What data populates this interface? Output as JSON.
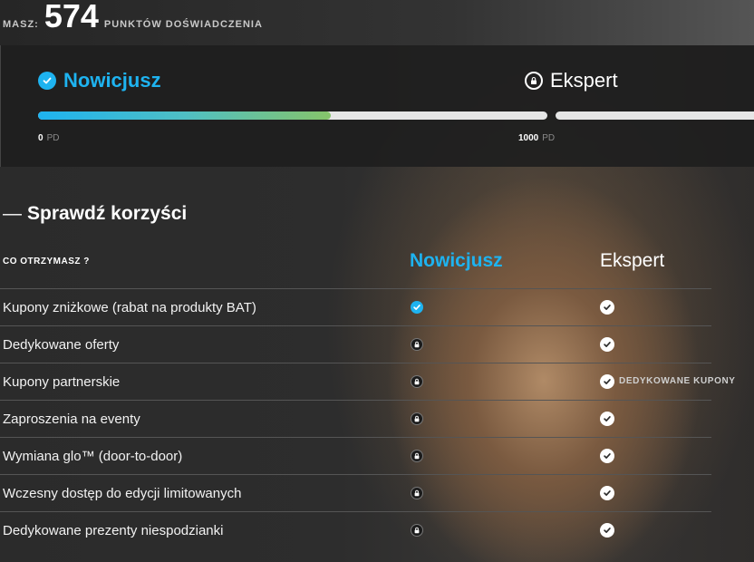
{
  "header": {
    "label": "MASZ:",
    "points": "574",
    "unit": "PUNKTÓW DOŚWIADCZENIA"
  },
  "levels": {
    "current": "Nowicjusz",
    "next": "Ekspert",
    "progress_fraction": 0.574,
    "tick_start_value": "0",
    "tick_end_value": "1000",
    "tick_unit": "PD"
  },
  "benefits": {
    "heading_dash": "—",
    "heading": "Sprawdź korzyści",
    "col_label": "CO OTRZYMASZ ?",
    "col_level1": "Nowicjusz",
    "col_level2": "Ekspert",
    "rows": [
      {
        "label": "Kupony zniżkowe (rabat na produkty BAT)",
        "level1": "check-icon",
        "level2": "check-icon",
        "note": ""
      },
      {
        "label": "Dedykowane oferty",
        "level1": "lock-icon",
        "level2": "check-icon",
        "note": ""
      },
      {
        "label": "Kupony partnerskie",
        "level1": "lock-icon",
        "level2": "check-icon",
        "note": "DEDYKOWANE KUPONY"
      },
      {
        "label": "Zaproszenia na eventy",
        "level1": "lock-icon",
        "level2": "check-icon",
        "note": ""
      },
      {
        "label": "Wymiana glo™ (door-to-door)",
        "level1": "lock-icon",
        "level2": "check-icon",
        "note": ""
      },
      {
        "label": "Wczesny dostęp do edycji limitowanych",
        "level1": "lock-icon",
        "level2": "check-icon",
        "note": ""
      },
      {
        "label": "Dedykowane prezenty niespodzianki",
        "level1": "lock-icon",
        "level2": "check-icon",
        "note": ""
      }
    ]
  },
  "colors": {
    "accent": "#1eb3f0",
    "progress_end": "#86c46a"
  }
}
